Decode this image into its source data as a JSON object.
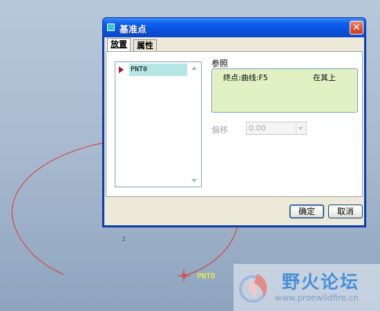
{
  "dialog": {
    "title": "基准点",
    "close_symbol": "✕",
    "tabs": [
      {
        "label": "放置",
        "active": true
      },
      {
        "label": "属性",
        "active": false
      }
    ],
    "point_list": {
      "items": [
        "PNT0"
      ],
      "selected": "PNT0"
    },
    "references": {
      "label": "参照",
      "items": [
        {
          "item": "终点:曲线:F5",
          "constraint": "在其上"
        }
      ]
    },
    "offset": {
      "label": "偏移",
      "value": "0.00",
      "enabled": false
    },
    "buttons": {
      "ok": "确定",
      "cancel": "取消"
    }
  },
  "viewport": {
    "curve_label": "2",
    "point_label": "PNT0",
    "curve_color": "#e0302a",
    "point_label_color": "#ffff30"
  },
  "watermark": {
    "title": "野火论坛",
    "url": "www.proewildfire.cn"
  }
}
